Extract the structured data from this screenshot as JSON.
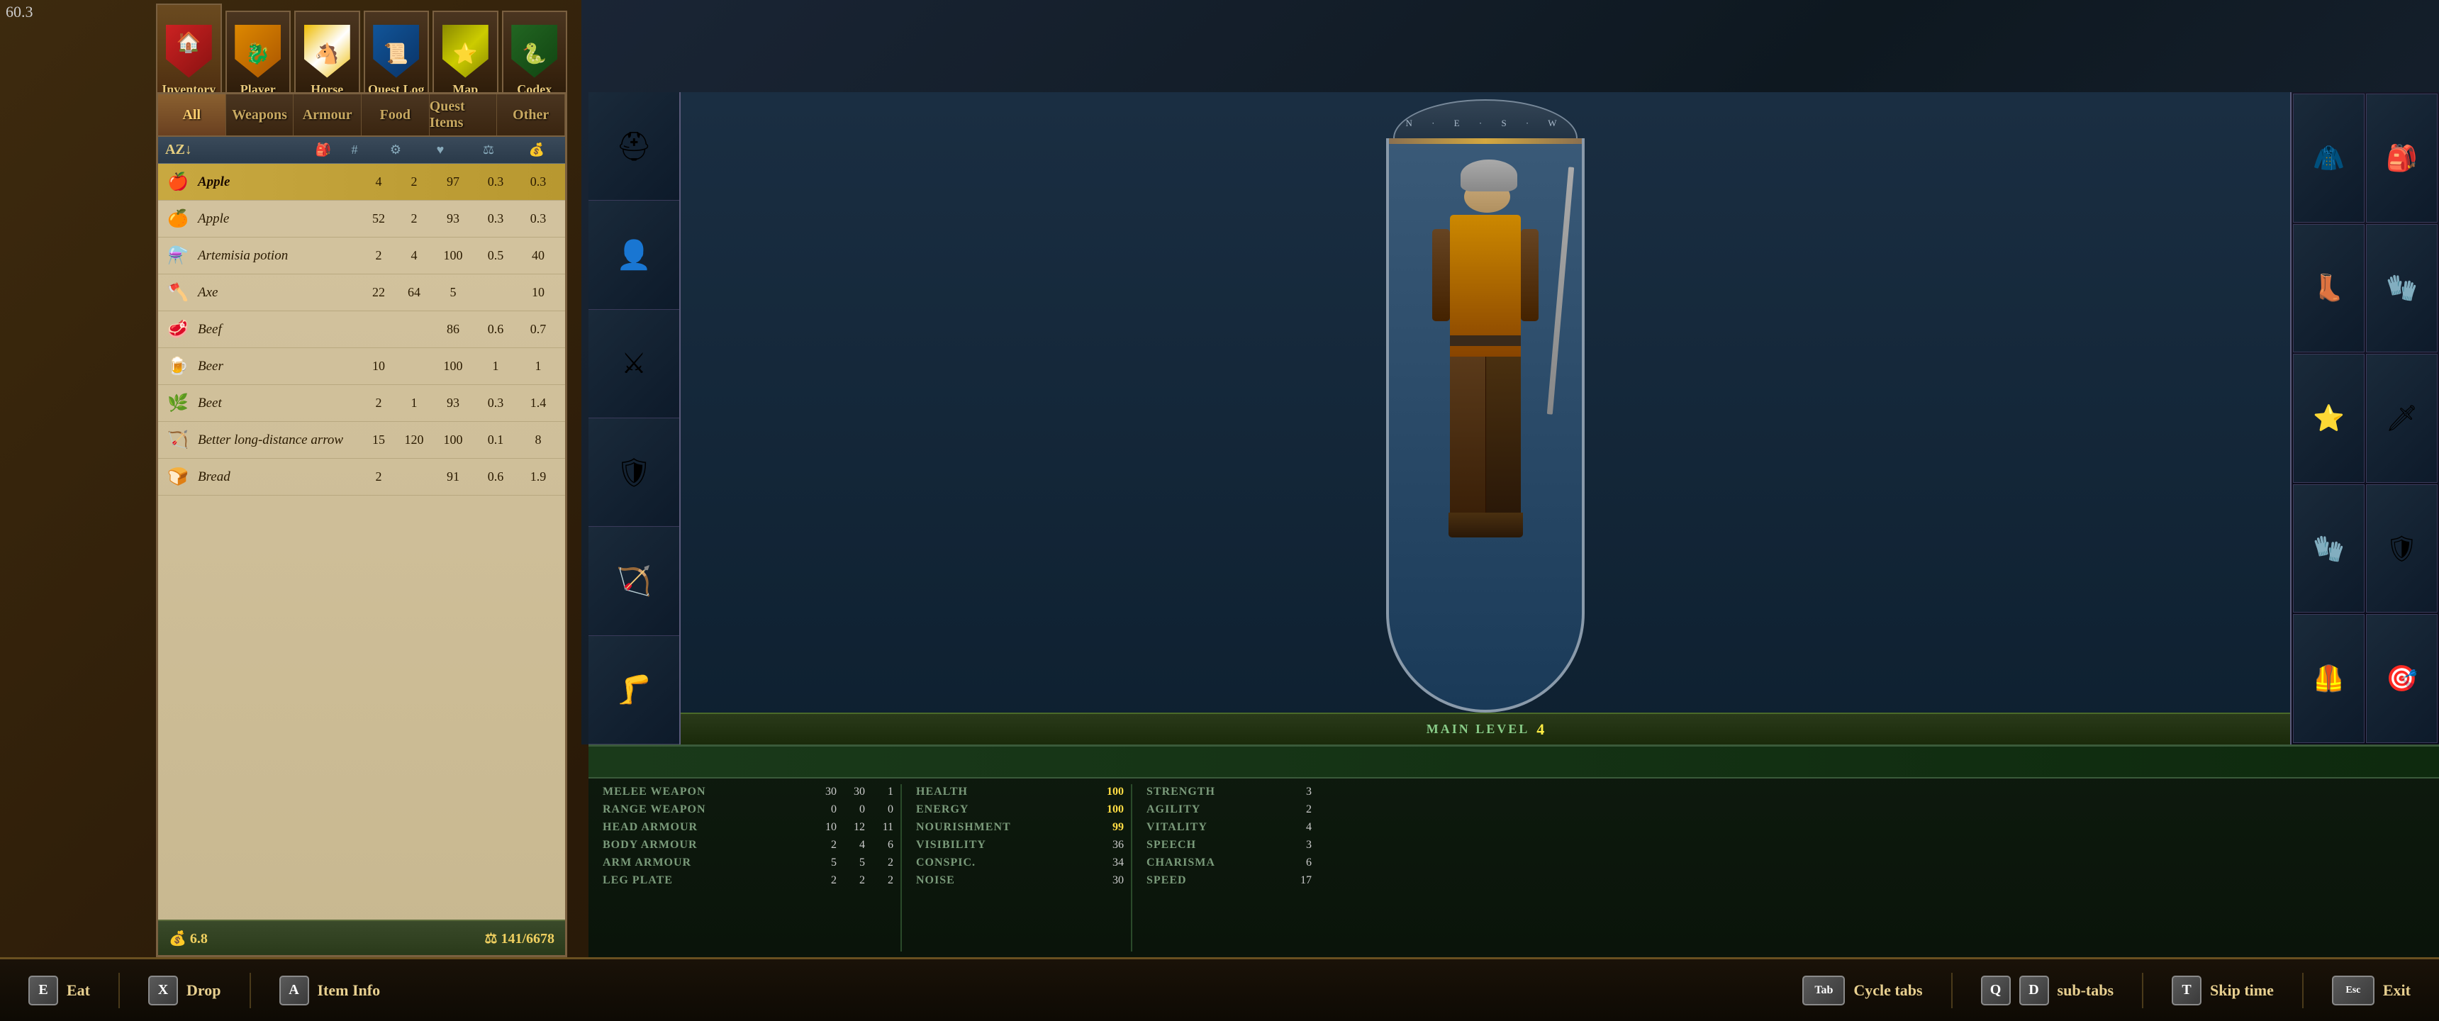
{
  "version": "60.3",
  "topNav": {
    "tabs": [
      {
        "id": "inventory",
        "label": "Inventory",
        "active": true,
        "icon": "🏠"
      },
      {
        "id": "player",
        "label": "Player",
        "active": false,
        "icon": "👤"
      },
      {
        "id": "horse",
        "label": "Horse",
        "active": false,
        "icon": "🐴"
      },
      {
        "id": "questlog",
        "label": "Quest Log",
        "active": false,
        "icon": "📜"
      },
      {
        "id": "map",
        "label": "Map",
        "active": false,
        "icon": "🗺"
      },
      {
        "id": "codex",
        "label": "Codex",
        "active": false,
        "icon": "📖"
      }
    ]
  },
  "categoryTabs": [
    {
      "id": "all",
      "label": "All",
      "active": true
    },
    {
      "id": "weapons",
      "label": "Weapons",
      "active": false
    },
    {
      "id": "armour",
      "label": "Armour",
      "active": false
    },
    {
      "id": "food",
      "label": "Food",
      "active": false
    },
    {
      "id": "questitems",
      "label": "Quest Items",
      "active": false
    },
    {
      "id": "other",
      "label": "Other",
      "active": false
    }
  ],
  "colHeaders": {
    "name": "AZ↓",
    "icon": "🎒",
    "qty": "#",
    "sym1": "⚙",
    "sym2": "♥",
    "weight": "⚖",
    "val": "💰"
  },
  "items": [
    {
      "id": 1,
      "name": "Apple",
      "qty": "4",
      "price": "2",
      "cond": "97",
      "weight": "0.3",
      "val": "0.3",
      "selected": true,
      "icon": "🍎"
    },
    {
      "id": 2,
      "name": "Apple",
      "qty": "52",
      "price": "2",
      "cond": "93",
      "weight": "0.3",
      "val": "0.3",
      "selected": false,
      "icon": "🍊"
    },
    {
      "id": 3,
      "name": "Artemisia potion",
      "qty": "2",
      "price": "4",
      "cond": "100",
      "weight": "0.5",
      "val": "40",
      "selected": false,
      "icon": "⚗"
    },
    {
      "id": 4,
      "name": "Axe",
      "qty": "22",
      "price": "64",
      "cond": "5",
      "weight": "",
      "val": "10",
      "selected": false,
      "icon": "🪓"
    },
    {
      "id": 5,
      "name": "Beef",
      "qty": "",
      "price": "",
      "cond": "86",
      "weight": "0.6",
      "val": "0.7",
      "selected": false,
      "icon": "🥩"
    },
    {
      "id": 6,
      "name": "Beer",
      "qty": "10",
      "price": "",
      "cond": "100",
      "weight": "1",
      "val": "1",
      "selected": false,
      "icon": "🍺"
    },
    {
      "id": 7,
      "name": "Beet",
      "qty": "2",
      "price": "1",
      "cond": "93",
      "weight": "0.3",
      "val": "1.4",
      "selected": false,
      "icon": "🌿"
    },
    {
      "id": 8,
      "name": "Better long-distance arrow",
      "qty": "15",
      "price": "120",
      "cond": "100",
      "weight": "0.1",
      "val": "8",
      "selected": false,
      "icon": "🪃"
    },
    {
      "id": 9,
      "name": "Bread",
      "qty": "2",
      "price": "",
      "cond": "91",
      "weight": "0.6",
      "val": "1.9",
      "selected": false,
      "icon": "🍞"
    }
  ],
  "footer": {
    "gold": "6.8",
    "weight": "141/6678",
    "goldIcon": "💰",
    "weightIcon": "⚖"
  },
  "character": {
    "mainLevel": "MAIN LEVEL",
    "levelNum": "4"
  },
  "stats": {
    "rows": [
      {
        "label": "MELEE WEAPON",
        "v1": "30",
        "v2": "30",
        "v3": "1",
        "highlight": false
      },
      {
        "label": "RANGE WEAPON",
        "v1": "0",
        "v2": "0",
        "v3": "0",
        "highlight": false
      },
      {
        "label": "HEAD ARMOUR",
        "v1": "10",
        "v2": "12",
        "v3": "11",
        "highlight": false
      },
      {
        "label": "BODY ARMOUR",
        "v1": "2",
        "v2": "4",
        "v3": "6",
        "highlight": false
      },
      {
        "label": "ARM ARMOUR",
        "v1": "5",
        "v2": "5",
        "v3": "2",
        "highlight": false
      },
      {
        "label": "LEG PLATE",
        "v1": "2",
        "v2": "2",
        "v3": "2",
        "highlight": false
      }
    ],
    "vitalStats": [
      {
        "label": "HEALTH",
        "value": "100",
        "highlight": true
      },
      {
        "label": "ENERGY",
        "value": "100",
        "highlight": true
      },
      {
        "label": "NOURISHMENT",
        "value": "99",
        "highlight": true
      },
      {
        "label": "VISIBILITY",
        "value": "36",
        "highlight": false
      },
      {
        "label": "CONSPIC.",
        "value": "34",
        "highlight": false
      },
      {
        "label": "NOISE",
        "value": "30",
        "highlight": false
      }
    ],
    "attributes": [
      {
        "label": "STRENGTH",
        "value": "3"
      },
      {
        "label": "AGILITY",
        "value": "2"
      },
      {
        "label": "VITALITY",
        "value": "4"
      },
      {
        "label": "SPEECH",
        "value": "3"
      },
      {
        "label": "CHARISMA",
        "value": "6"
      },
      {
        "label": "SPEED",
        "value": "17"
      }
    ]
  },
  "actions": [
    {
      "key": "E",
      "label": "Eat"
    },
    {
      "key": "X",
      "label": "Drop"
    },
    {
      "key": "A",
      "label": "Item Info"
    },
    {
      "key": "Tab",
      "label": "Cycle tabs"
    },
    {
      "key": "Q",
      "label": ""
    },
    {
      "key": "D",
      "label": "sub-tabs"
    },
    {
      "key": "T",
      "label": "Skip time"
    },
    {
      "key": "Esc",
      "label": "Exit"
    }
  ],
  "equipLeft": [
    "🪖",
    "👕",
    "⚔",
    "🛡",
    "🧤",
    "🦵"
  ],
  "equipRight": [
    "👚",
    "🎒",
    "🥾",
    "🥋",
    "💍",
    "🗡",
    "🧤",
    "🛡",
    "🦺",
    "🎯"
  ]
}
